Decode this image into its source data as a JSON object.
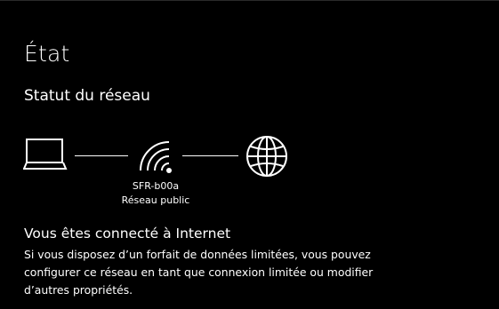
{
  "page": {
    "title": "État"
  },
  "network_status": {
    "section_title": "Statut du réseau",
    "diagram": {
      "nodes": [
        {
          "icon": "laptop-icon"
        },
        {
          "icon": "wifi-icon",
          "name": "SFR-b00a",
          "type": "Réseau public"
        },
        {
          "icon": "globe-icon"
        }
      ]
    },
    "connection_heading": "Vous êtes connecté à Internet",
    "connection_description": "Si vous disposez d’un forfait de données limitées, vous pouvez configurer ce réseau en tant que connexion limitée ou modifier d’autres propriétés."
  },
  "colors": {
    "background": "#000000",
    "foreground": "#ffffff"
  }
}
